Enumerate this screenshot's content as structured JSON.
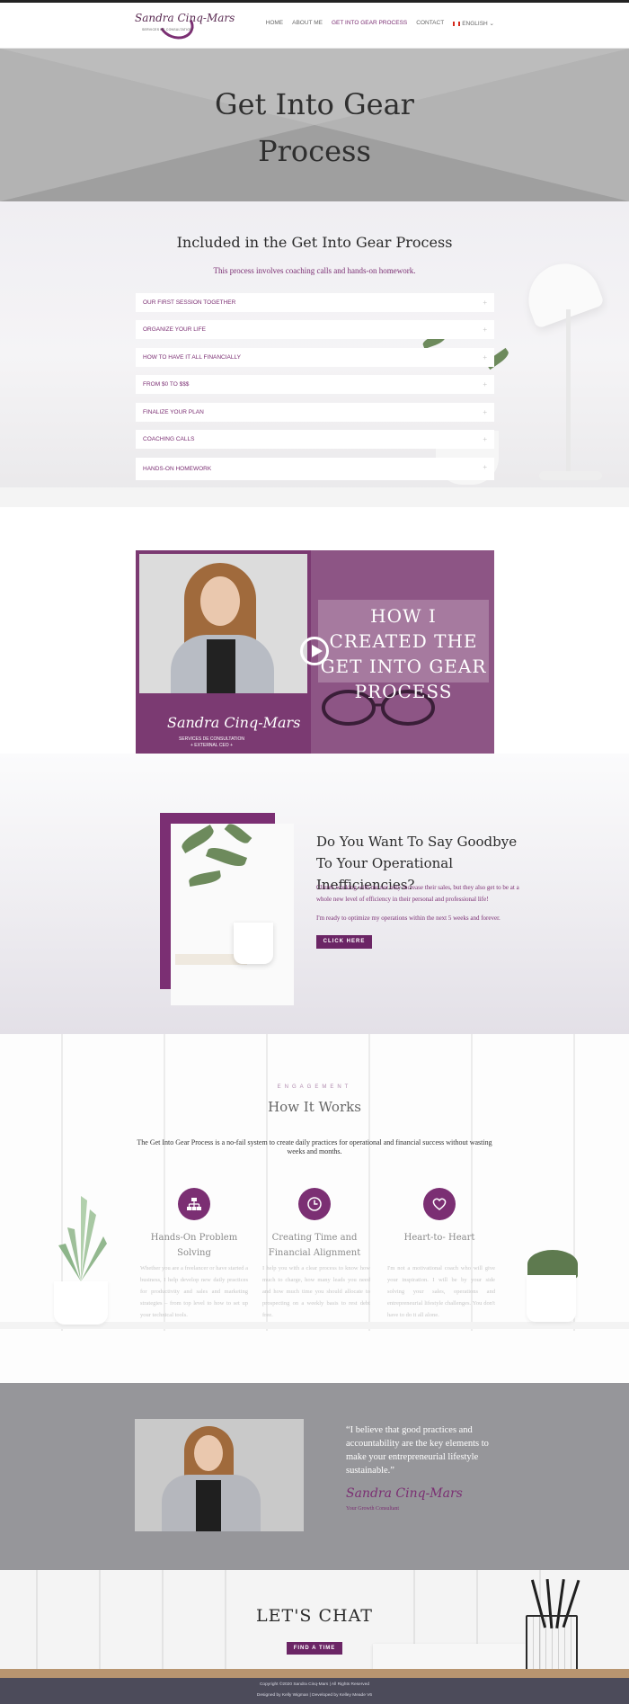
{
  "header": {
    "logo_script": "Sandra Cinq-Mars",
    "logo_subtitle": "SERVICES DE CONSULTATION",
    "nav": [
      "HOME",
      "ABOUT ME",
      "GET INTO GEAR PROCESS",
      "CONTACT",
      "ENGLISH"
    ],
    "active_nav": "GET INTO GEAR PROCESS",
    "accent_color": "#7b2f73"
  },
  "hero": {
    "title_line1": "Get Into Gear",
    "title_line2": "Process"
  },
  "included": {
    "title": "Included in the Get Into Gear Process",
    "intro": "This process involves coaching calls and hands-on homework.",
    "items": [
      "OUR FIRST SESSION TOGETHER",
      "ORGANIZE YOUR LIFE",
      "HOW TO HAVE IT ALL FINANCIALLY",
      "FROM $0 TO $$$",
      "FINALIZE YOUR PLAN",
      "COACHING CALLS",
      "HANDS-ON HOMEWORK"
    ]
  },
  "video": {
    "title": "HOW I CREATED THE GET INTO GEAR PROCESS",
    "brand": "Sandra Cinq-Mars",
    "brand_line1": "SERVICES DE CONSULTATION",
    "brand_line2": "+ EXTERNAL CEO +",
    "play_icon": "play-icon"
  },
  "goodbye": {
    "title": "Do You Want To Say Goodbye To Your Operational Inefficiencies?",
    "p1": "Clients working with me not only increase their sales, but they also get to be at a whole new level of efficiency in their personal and professional life!",
    "p2": "I'm ready to optimize my operations within the next 5 weeks and forever.",
    "button": "CLICK HERE"
  },
  "how": {
    "eyebrow": "ENGAGEMENT",
    "title": "How It Works",
    "lead": "The Get Into Gear Process is a no-fail system to create daily practices for operational and financial success without wasting weeks and months.",
    "cards": [
      {
        "icon": "hierarchy-icon",
        "title": "Hands-On Problem Solving",
        "text": "Whether you are a freelancer or have started a business, I help develop new daily practices for productivity and sales and marketing strategies – from top level to how to set up your technical tools."
      },
      {
        "icon": "clock-icon",
        "title": "Creating Time and Financial Alignment",
        "text": "I help you with a clear process to know how much to charge, how many leads you need and how much time you should allocate to prospecting on a weekly basis to rest debt free."
      },
      {
        "icon": "heart-icon",
        "title": "Heart-to- Heart",
        "text": "I'm not a motivational coach who will give your inspiration. I will be by your side solving your sales, operations and entrepreneurial lifestyle challenges. You don't have to do it all alone."
      }
    ]
  },
  "quote": {
    "text": "“I believe that good practices and accountability are the key elements to make your entrepreneurial lifestyle sustainable.”",
    "signature": "Sandra Cinq-Mars",
    "role": "Your Growth Consultant"
  },
  "chat": {
    "title": "LET'S CHAT",
    "button": "FIND A TIME"
  },
  "footer": {
    "line1": "Copyright ©2020 Sandra Cinq-Mars | All Rights Reserved",
    "line2": "Designed by Kelly Wigman | Developed by Kelley Meade V6"
  }
}
